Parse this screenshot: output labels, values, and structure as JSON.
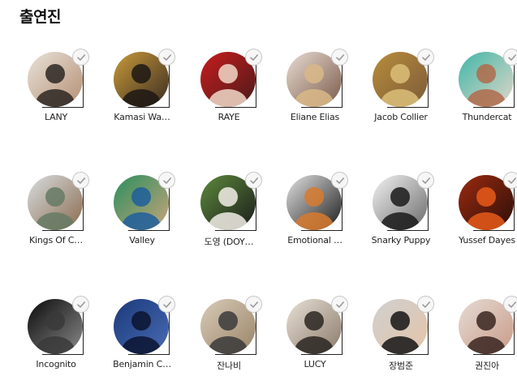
{
  "section": {
    "title": "출연진"
  },
  "performers": [
    {
      "name": "LANY",
      "colors": [
        "#e8e2da",
        "#2b2622",
        "#b58f73"
      ]
    },
    {
      "name": "Kamasi Wa…",
      "colors": [
        "#c89a3a",
        "#1c1714",
        "#3a2c22"
      ]
    },
    {
      "name": "RAYE",
      "colors": [
        "#c81d1d",
        "#f1d8c8",
        "#4a1a1a"
      ]
    },
    {
      "name": "Eliane Elias",
      "colors": [
        "#e8dcd2",
        "#d9b987",
        "#7a5a4a"
      ]
    },
    {
      "name": "Jacob Collier",
      "colors": [
        "#b88d3a",
        "#dcc07a",
        "#7c5a3a"
      ]
    },
    {
      "name": "Thundercat",
      "colors": [
        "#3fb7a8",
        "#b06a4a",
        "#e2d6c8"
      ]
    },
    {
      "name": "Kings Of C…",
      "colors": [
        "#d8dde0",
        "#667a64",
        "#8a6a4e"
      ]
    },
    {
      "name": "Valley",
      "colors": [
        "#2b8e5e",
        "#1e5e9c",
        "#c8a47a"
      ]
    },
    {
      "name": "도영 (DOY…",
      "colors": [
        "#5d8a3c",
        "#f2ede6",
        "#1b1b1b"
      ]
    },
    {
      "name": "Emotional …",
      "colors": [
        "#e2e2e2",
        "#d87a2e",
        "#1c1c1c"
      ]
    },
    {
      "name": "Snarky Puppy",
      "colors": [
        "#f3f3f3",
        "#1a1a1a",
        "#6a6a6a"
      ]
    },
    {
      "name": "Yussef Dayes",
      "colors": [
        "#9c2a10",
        "#e85a1a",
        "#2a0f08"
      ]
    },
    {
      "name": "Incognito",
      "colors": [
        "#0a0a0a",
        "#3a3a3a",
        "#8a8a8a"
      ]
    },
    {
      "name": "Benjamin C…",
      "colors": [
        "#1a3a7a",
        "#0a1430",
        "#4a6ab4"
      ]
    },
    {
      "name": "잔나비",
      "colors": [
        "#d8cbb8",
        "#3a3a3a",
        "#9a8468"
      ]
    },
    {
      "name": "LUCY",
      "colors": [
        "#e8e0d6",
        "#2a2622",
        "#8a7a6a"
      ]
    },
    {
      "name": "장범준",
      "colors": [
        "#d0d0d0",
        "#141414",
        "#e4c4a8"
      ]
    },
    {
      "name": "권진아",
      "colors": [
        "#e6dcd4",
        "#3a2420",
        "#c89a88"
      ]
    }
  ]
}
